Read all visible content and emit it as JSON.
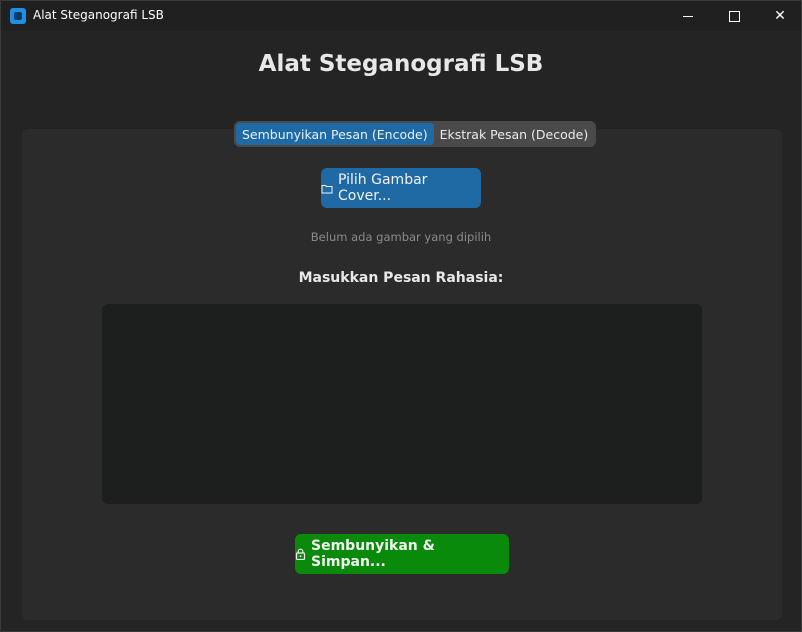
{
  "window": {
    "title": "Alat Steganografi LSB",
    "controls": {
      "minimize": "—",
      "maximize": "☐",
      "close": "✕"
    }
  },
  "header": {
    "title": "Alat Steganografi LSB"
  },
  "tabs": [
    {
      "label": "Sembunyikan Pesan (Encode)",
      "active": true
    },
    {
      "label": "Ekstrak Pesan (Decode)",
      "active": false
    }
  ],
  "encode": {
    "choose_cover_button": {
      "icon": "folder-icon",
      "label": "Pilih Gambar Cover..."
    },
    "no_image_text": "Belum ada gambar yang dipilih",
    "message_label": "Masukkan Pesan Rahasia:",
    "message_value": "",
    "hide_save_button": {
      "icon": "lock-icon",
      "label": "Sembunyikan & Simpan..."
    }
  },
  "colors": {
    "accent": "#1f6aa5",
    "success": "#0a8a0a",
    "background": "#242424",
    "panel": "#2b2b2b"
  }
}
